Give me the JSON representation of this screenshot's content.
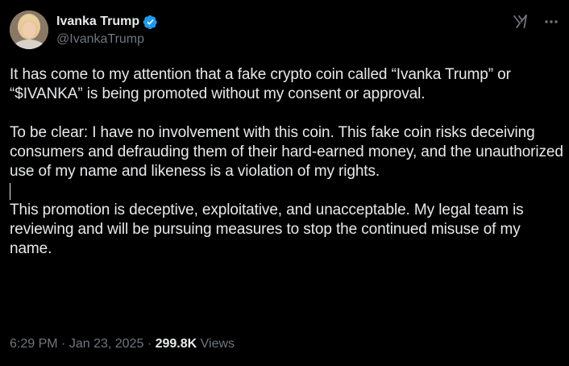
{
  "author": {
    "display_name": "Ivanka Trump",
    "handle": "@IvankaTrump",
    "verified": true,
    "verified_color": "#1d9bf0"
  },
  "icons": {
    "verified": "verified-badge-icon",
    "grok": "grok-icon",
    "more": "more-options-icon"
  },
  "post": {
    "paragraphs": [
      "It has come to my attention that a fake crypto coin called “Ivanka Trump” or “$IVANKA” is being promoted without my consent or approval.",
      "To be clear: I have no involvement with this coin. This fake coin risks deceiving consumers and defrauding them of their hard-earned money, and the unauthorized use of my name and likeness is a violation of my rights.",
      "This promotion is deceptive, exploitative, and unacceptable. My legal team is reviewing and will be pursuing measures to stop the continued misuse of my name."
    ]
  },
  "meta": {
    "time": "6:29 PM",
    "separator": "·",
    "date": "Jan 23, 2025",
    "views_count": "299.8K",
    "views_label": "Views"
  },
  "colors": {
    "background": "#000000",
    "text_primary": "#e7e9ea",
    "text_secondary": "#71767b",
    "accent": "#1d9bf0"
  }
}
